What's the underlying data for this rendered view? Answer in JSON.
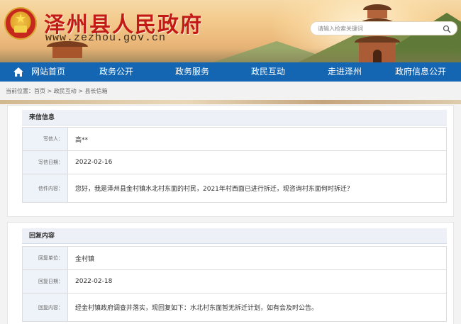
{
  "header": {
    "site_title": "泽州县人民政府",
    "site_url": "www.zezhou.gov.cn",
    "search_placeholder": "请输入检索关键词"
  },
  "nav": {
    "items": [
      "网站首页",
      "政务公开",
      "政务服务",
      "政民互动",
      "走进泽州",
      "政府信息公开"
    ]
  },
  "breadcrumb": {
    "text": "当前位置：首页 > 政民互动 > 县长信箱"
  },
  "letter": {
    "title": "来信信息",
    "rows": [
      {
        "label": "写信人：",
        "value": "高**"
      },
      {
        "label": "写信日期：",
        "value": "2022-02-16"
      },
      {
        "label": "信件内容：",
        "value": "您好，我是泽州县金村镇水北村东面的村民，2021年村西面已进行拆迁，现咨询村东面何时拆迁？"
      }
    ]
  },
  "reply": {
    "title": "回复内容",
    "rows": [
      {
        "label": "回复单位：",
        "value": "金村镇"
      },
      {
        "label": "回复日期：",
        "value": "2022-02-18"
      },
      {
        "label": "回复内容：",
        "value": "经金村镇政府调查并落实，现回复如下：水北村东面暂无拆迁计划，如有会及时公告。"
      }
    ]
  },
  "colors": {
    "nav_bg": "#1466b3",
    "title_red": "#c41a16",
    "panel_title_bg": "#edf1f7"
  },
  "icons": {
    "home": "home-icon",
    "search": "search-icon",
    "emblem": "national-emblem-icon"
  }
}
